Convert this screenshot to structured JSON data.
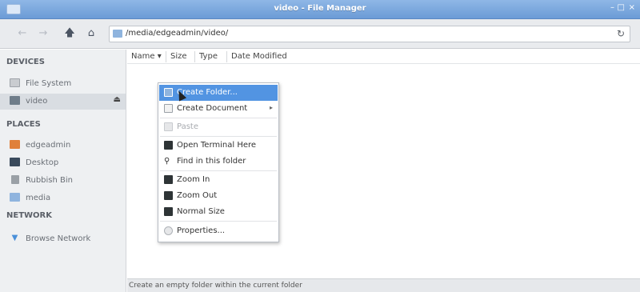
{
  "window": {
    "title": "video - File Manager",
    "controls": {
      "minimize": "–",
      "maximize": "□",
      "close": "×"
    }
  },
  "toolbar": {
    "back_icon": "left-arrow-icon",
    "forward_icon": "right-arrow-icon",
    "up_icon": "up-arrow-icon",
    "home_icon": "home-icon",
    "path": "/media/edgeadmin/video/",
    "reload_icon": "reload-icon"
  },
  "sidebar": {
    "devices_heading": "DEVICES",
    "devices": [
      {
        "label": "File System",
        "icon": "drive-icon",
        "color": "#c9ccd0"
      },
      {
        "label": "video",
        "icon": "usb-drive-icon",
        "color": "#6f7d8a",
        "eject": "⏏",
        "selected": true
      }
    ],
    "places_heading": "PLACES",
    "places": [
      {
        "label": "edgeadmin",
        "icon": "home-folder-icon",
        "color": "#e0803a"
      },
      {
        "label": "Desktop",
        "icon": "desktop-icon",
        "color": "#3a4a5c"
      },
      {
        "label": "Rubbish Bin",
        "icon": "trash-icon",
        "color": "#9aa0a6"
      },
      {
        "label": "media",
        "icon": "folder-icon",
        "color": "#8fb4de"
      }
    ],
    "network_heading": "NETWORK",
    "network": [
      {
        "label": "Browse Network",
        "icon": "network-icon",
        "color": "#4a90d9"
      }
    ]
  },
  "columns": {
    "name": "Name",
    "sort_indicator": "▾",
    "size": "Size",
    "type": "Type",
    "date_modified": "Date Modified"
  },
  "context_menu": {
    "items": [
      {
        "label": "Create Folder...",
        "icon": "new-folder-icon",
        "highlighted": true
      },
      {
        "label": "Create Document",
        "icon": "new-document-icon",
        "submenu": "▸"
      },
      {
        "label": "Paste",
        "icon": "paste-icon",
        "disabled": true
      },
      {
        "label": "Open Terminal Here",
        "icon": "terminal-icon"
      },
      {
        "label": "Find in this folder",
        "icon": "search-icon"
      },
      {
        "label": "Zoom In",
        "icon": "zoom-in-icon"
      },
      {
        "label": "Zoom Out",
        "icon": "zoom-out-icon"
      },
      {
        "label": "Normal Size",
        "icon": "zoom-normal-icon"
      },
      {
        "label": "Properties...",
        "icon": "properties-icon"
      }
    ]
  },
  "status": {
    "text": "Create an empty folder within the current folder"
  },
  "colors": {
    "accent": "#5294e2",
    "titlebar": "#7ba7de"
  }
}
